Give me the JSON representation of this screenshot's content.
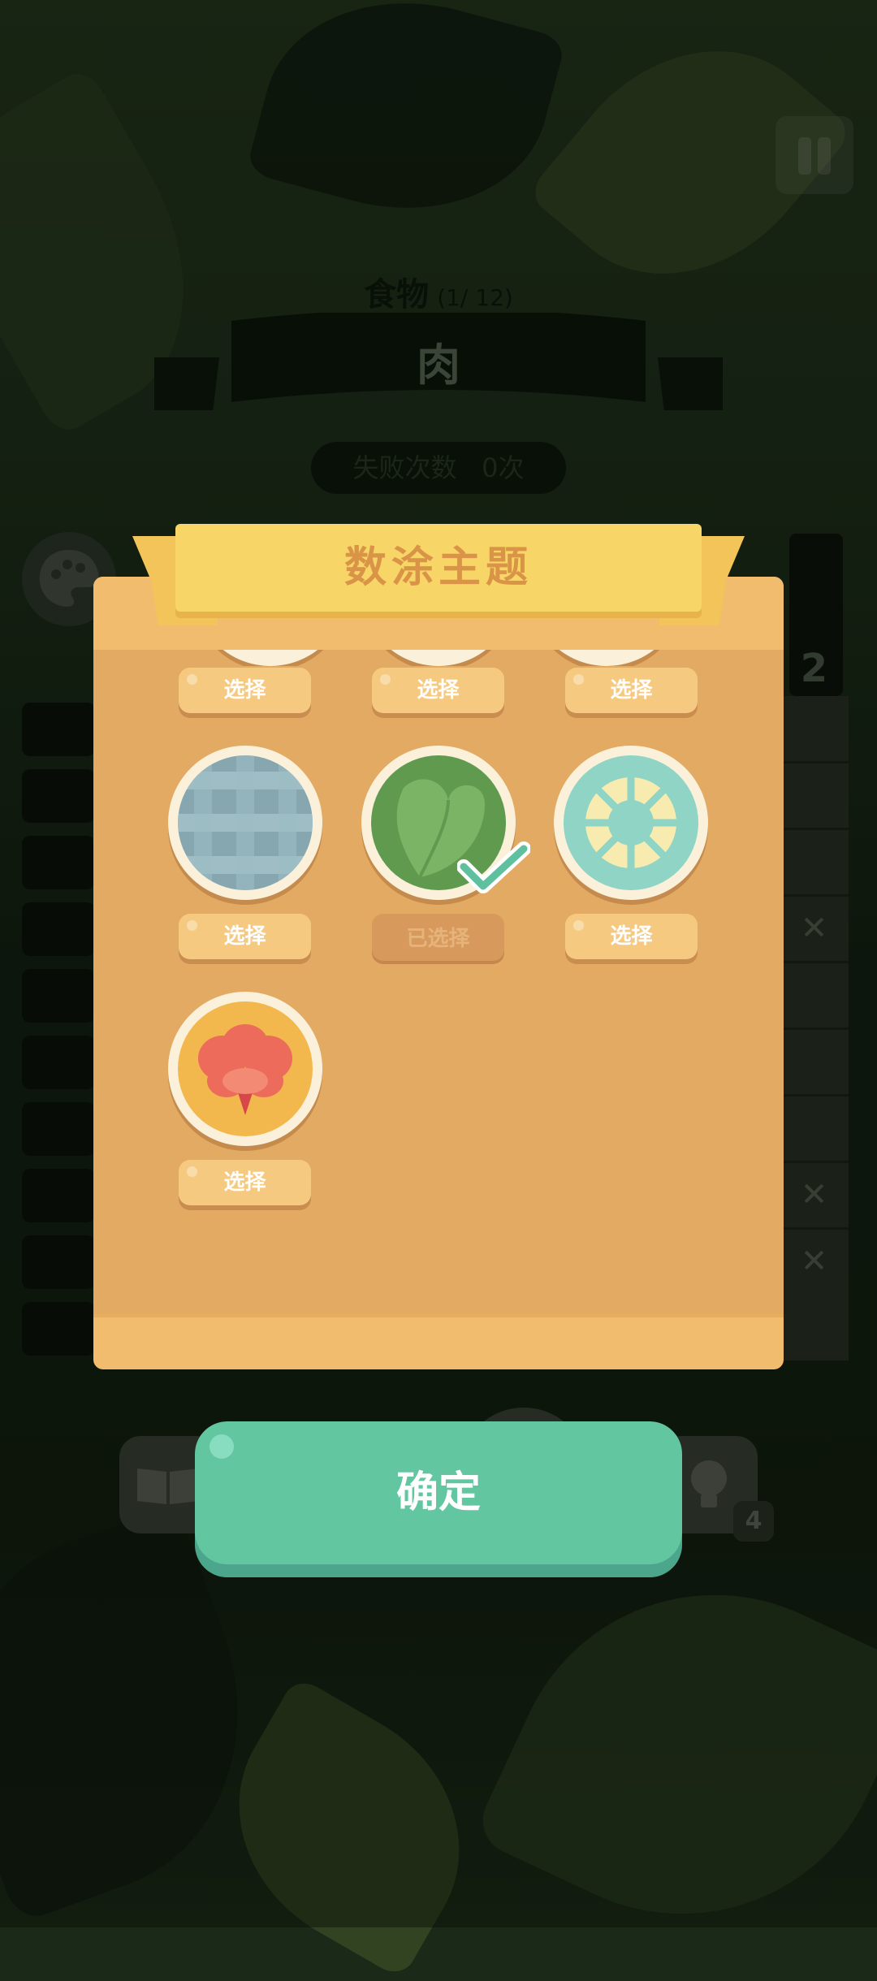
{
  "level": {
    "category": "食物",
    "progress": "(1/ 12)",
    "word": "肉",
    "fail_label": "失败次数",
    "fail_count": "0次"
  },
  "board": {
    "column_number": "2",
    "cells": [
      "",
      "",
      "",
      "✕",
      "",
      "",
      "",
      "✕",
      "✕"
    ]
  },
  "hint_count": "4",
  "dialog": {
    "title": "数涂主题",
    "items": [
      {
        "name": "plaid-theme",
        "button": "选择",
        "selected": false
      },
      {
        "name": "leaf-theme",
        "button": "已选择",
        "selected": true
      },
      {
        "name": "citrus-theme",
        "button": "选择",
        "selected": false
      },
      {
        "name": "hibiscus-theme",
        "button": "选择",
        "selected": false
      }
    ],
    "top_row_buttons": [
      "选择",
      "选择",
      "选择"
    ]
  },
  "confirm_label": "确定",
  "colors": {
    "dialog": "#e2aa62",
    "ribbon": "#f8d567",
    "confirm": "#62c6a1"
  }
}
